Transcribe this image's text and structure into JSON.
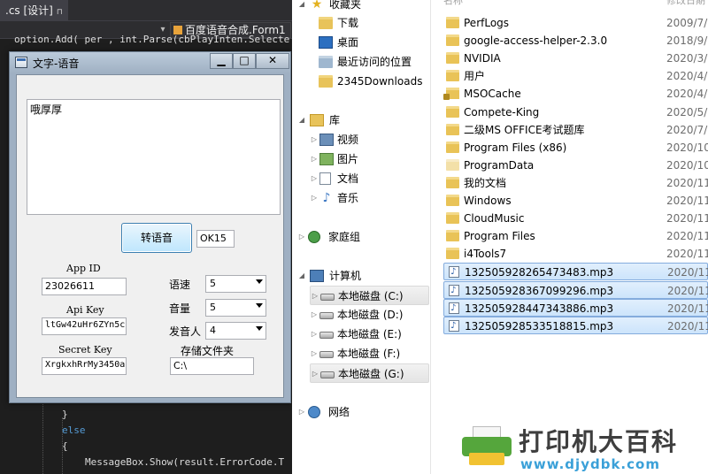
{
  "editor": {
    "tab_label": ".cs [设计]",
    "nav_dropdown": "百度语音合成.Form1",
    "code_top": "option.Add( per , int.Parse(cbPlayInten.Selecte",
    "code_lines": [
      {
        "text": "}",
        "kind": "plain"
      },
      {
        "text": "else",
        "kind": "keyword"
      },
      {
        "text": "{",
        "kind": "plain"
      },
      {
        "text": "MessageBox.Show(result.ErrorCode.T",
        "kind": "plain"
      },
      {
        "text": "}",
        "kind": "plain"
      }
    ]
  },
  "dialog": {
    "title": "文字-语音",
    "min_glyph": "▁",
    "max_glyph": "□",
    "close_glyph": "✕",
    "text_content": "哦厚厚",
    "convert_button": "转语音",
    "status_value": "OK15",
    "app_id_label": "App ID",
    "app_id_value": "23026611",
    "api_key_label": "Api Key",
    "api_key_value": "ltGw42uHr6ZYn5cL",
    "secret_key_label": "Secret Key",
    "secret_key_value": "XrgkxhRrMy3450aL",
    "speed_label": "语速",
    "speed_value": "5",
    "volume_label": "音量",
    "volume_value": "5",
    "speaker_label": "发音人",
    "speaker_value": "4",
    "folder_label": "存储文件夹",
    "folder_value": "C:\\"
  },
  "explorer": {
    "nav": {
      "favorites": "收藏夹",
      "downloads": "下载",
      "desktop": "桌面",
      "recent": "最近访问的位置",
      "folder_2345": "2345Downloads",
      "libraries": "库",
      "videos": "视频",
      "pictures": "图片",
      "documents": "文档",
      "music": "音乐",
      "homegroup": "家庭组",
      "computer": "计算机",
      "drives": [
        "本地磁盘 (C:)",
        "本地磁盘 (D:)",
        "本地磁盘 (E:)",
        "本地磁盘 (F:)",
        "本地磁盘 (G:)"
      ],
      "network": "网络"
    },
    "header": {
      "name": "名称",
      "date": "修改日期"
    },
    "files": [
      {
        "name": "PerfLogs",
        "date": "2009/7/1",
        "icon": "folder"
      },
      {
        "name": "google-access-helper-2.3.0",
        "date": "2018/9/1",
        "icon": "folder"
      },
      {
        "name": "NVIDIA",
        "date": "2020/3/6",
        "icon": "folder"
      },
      {
        "name": "用户",
        "date": "2020/4/5",
        "icon": "folder"
      },
      {
        "name": "MSOCache",
        "date": "2020/4/6",
        "icon": "locked-folder"
      },
      {
        "name": "Compete-King",
        "date": "2020/5/1",
        "icon": "folder"
      },
      {
        "name": "二级MS OFFICE考试题库",
        "date": "2020/7/1",
        "icon": "folder"
      },
      {
        "name": "Program Files (x86)",
        "date": "2020/10/",
        "icon": "folder"
      },
      {
        "name": "ProgramData",
        "date": "2020/10/",
        "icon": "hidden-folder"
      },
      {
        "name": "我的文档",
        "date": "2020/11/",
        "icon": "folder"
      },
      {
        "name": "Windows",
        "date": "2020/11/",
        "icon": "folder"
      },
      {
        "name": "CloudMusic",
        "date": "2020/11/",
        "icon": "folder"
      },
      {
        "name": "Program Files",
        "date": "2020/11/",
        "icon": "folder"
      },
      {
        "name": "i4Tools7",
        "date": "2020/11/",
        "icon": "folder"
      },
      {
        "name": "132505928265473483.mp3",
        "date": "2020/11/",
        "icon": "mp3"
      },
      {
        "name": "132505928367099296.mp3",
        "date": "2020/11/",
        "icon": "mp3"
      },
      {
        "name": "132505928447343886.mp3",
        "date": "2020/11/",
        "icon": "mp3"
      },
      {
        "name": "132505928533518815.mp3",
        "date": "2020/11/",
        "icon": "mp3"
      }
    ]
  },
  "watermark": {
    "title": "打印机大百科",
    "url": "www.djydbk.com"
  }
}
